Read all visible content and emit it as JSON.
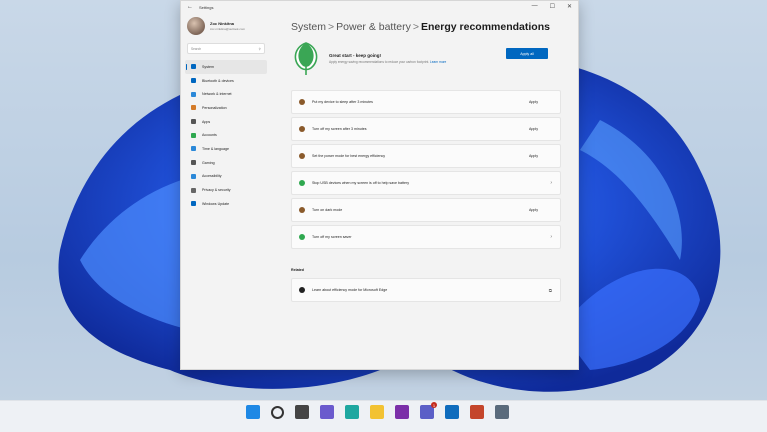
{
  "window": {
    "title": "Settings",
    "controls": [
      "—",
      "☐",
      "✕"
    ]
  },
  "profile": {
    "name": "Zoc Ninkitna",
    "email": "zoc.ninkitna@outlook.com"
  },
  "search": {
    "placeholder": "Search"
  },
  "sidebar": {
    "items": [
      {
        "label": "System",
        "icon": "monitor-icon",
        "color": "#0067c0",
        "active": true
      },
      {
        "label": "Bluetooth & devices",
        "icon": "bluetooth-icon",
        "color": "#0067c0"
      },
      {
        "label": "Network & internet",
        "icon": "wifi-icon",
        "color": "#2b88d8"
      },
      {
        "label": "Personalization",
        "icon": "brush-icon",
        "color": "#d47b28"
      },
      {
        "label": "Apps",
        "icon": "apps-icon",
        "color": "#555555"
      },
      {
        "label": "Accounts",
        "icon": "account-icon",
        "color": "#2fa84f"
      },
      {
        "label": "Time & language",
        "icon": "globe-icon",
        "color": "#2b88d8"
      },
      {
        "label": "Gaming",
        "icon": "gamepad-icon",
        "color": "#555555"
      },
      {
        "label": "Accessibility",
        "icon": "accessibility-icon",
        "color": "#2b88d8"
      },
      {
        "label": "Privacy & security",
        "icon": "shield-icon",
        "color": "#666666"
      },
      {
        "label": "Windows Update",
        "icon": "update-icon",
        "color": "#0067c0"
      }
    ]
  },
  "breadcrumb": {
    "parts": [
      "System",
      "Power & battery"
    ],
    "current": "Energy recommendations",
    "separator": ">"
  },
  "hero": {
    "title": "Great start - keep going!",
    "subtitle": "Apply energy saving recommendations to reduce your carbon footprint.",
    "link": "Learn more",
    "apply_all": "Apply all"
  },
  "recommendations": [
    {
      "text": "Put my device to sleep after 3 minutes",
      "status": "brown",
      "action": "Apply"
    },
    {
      "text": "Turn off my screen after 3 minutes",
      "status": "brown",
      "action": "Apply"
    },
    {
      "text": "Set the power mode for best energy efficiency",
      "status": "brown",
      "action": "Apply"
    },
    {
      "text": "Stop USB devices when my screen is off to help save battery",
      "status": "green",
      "action": "›"
    },
    {
      "text": "Turn on dark mode",
      "status": "brown",
      "action": "Apply"
    },
    {
      "text": "Turn off my screen saver",
      "status": "green",
      "action": "›"
    }
  ],
  "related": {
    "heading": "Related",
    "item": "Learn about efficiency mode for Microsoft Edge"
  },
  "colors": {
    "accent": "#0067c0",
    "pending": "#8a5a2b",
    "done": "#2fa84f"
  },
  "taskbar": {
    "icons": [
      "windows-start-icon",
      "search-icon",
      "task-view-icon",
      "widgets-icon",
      "edge-icon",
      "file-explorer-icon",
      "onenote-icon",
      "teams-icon",
      "outlook-icon",
      "powerpoint-icon",
      "settings-icon"
    ],
    "teams_badge": "1"
  }
}
